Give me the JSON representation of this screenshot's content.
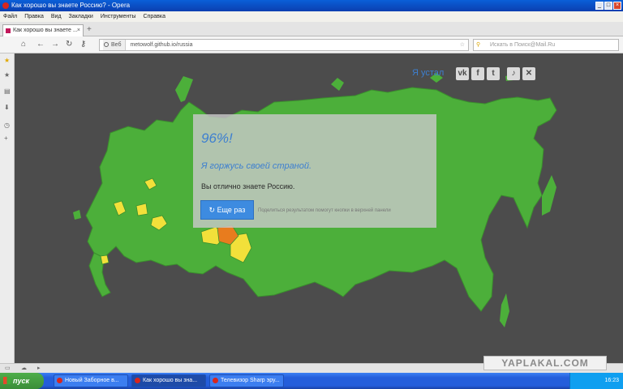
{
  "window": {
    "title": "Как хорошо вы знаете Россию? - Opera",
    "controls": [
      "_",
      "□",
      "×"
    ]
  },
  "menu": [
    "Файл",
    "Правка",
    "Вид",
    "Закладки",
    "Инструменты",
    "Справка"
  ],
  "tab": {
    "title": "Как хорошо вы знаете ...",
    "close": "×",
    "new_tab": "+"
  },
  "address": {
    "label": "Веб",
    "url": "metowolf.github.io/russia",
    "search_placeholder": "Искать в Поиск@Mail.Ru"
  },
  "page": {
    "tired_link": "Я устал",
    "social": [
      "vk",
      "f",
      "t"
    ],
    "controls": [
      "sound-icon",
      "close-icon"
    ],
    "result": {
      "percent": "96%!",
      "proud": "Я горжусь своей страной.",
      "verdict": "Вы отлично знаете Россию.",
      "again_button": "↻ Еще раз",
      "share_text": "Поделиться результатом помогут кнопки в верхней панели"
    },
    "colors": {
      "map_background": "#4c4c4c",
      "correct": "#4caf3a",
      "hint": "#f2e03a",
      "wrong": "#e87c1e",
      "accent": "#3d7fd0"
    }
  },
  "watermark": "YAPLAKAL.COM",
  "taskbar": {
    "start": "пуск",
    "tasks": [
      "Новый Заборное в...",
      "Как хорошо вы зна...",
      "Телевизор Sharp эру..."
    ],
    "clock": "16:23"
  }
}
